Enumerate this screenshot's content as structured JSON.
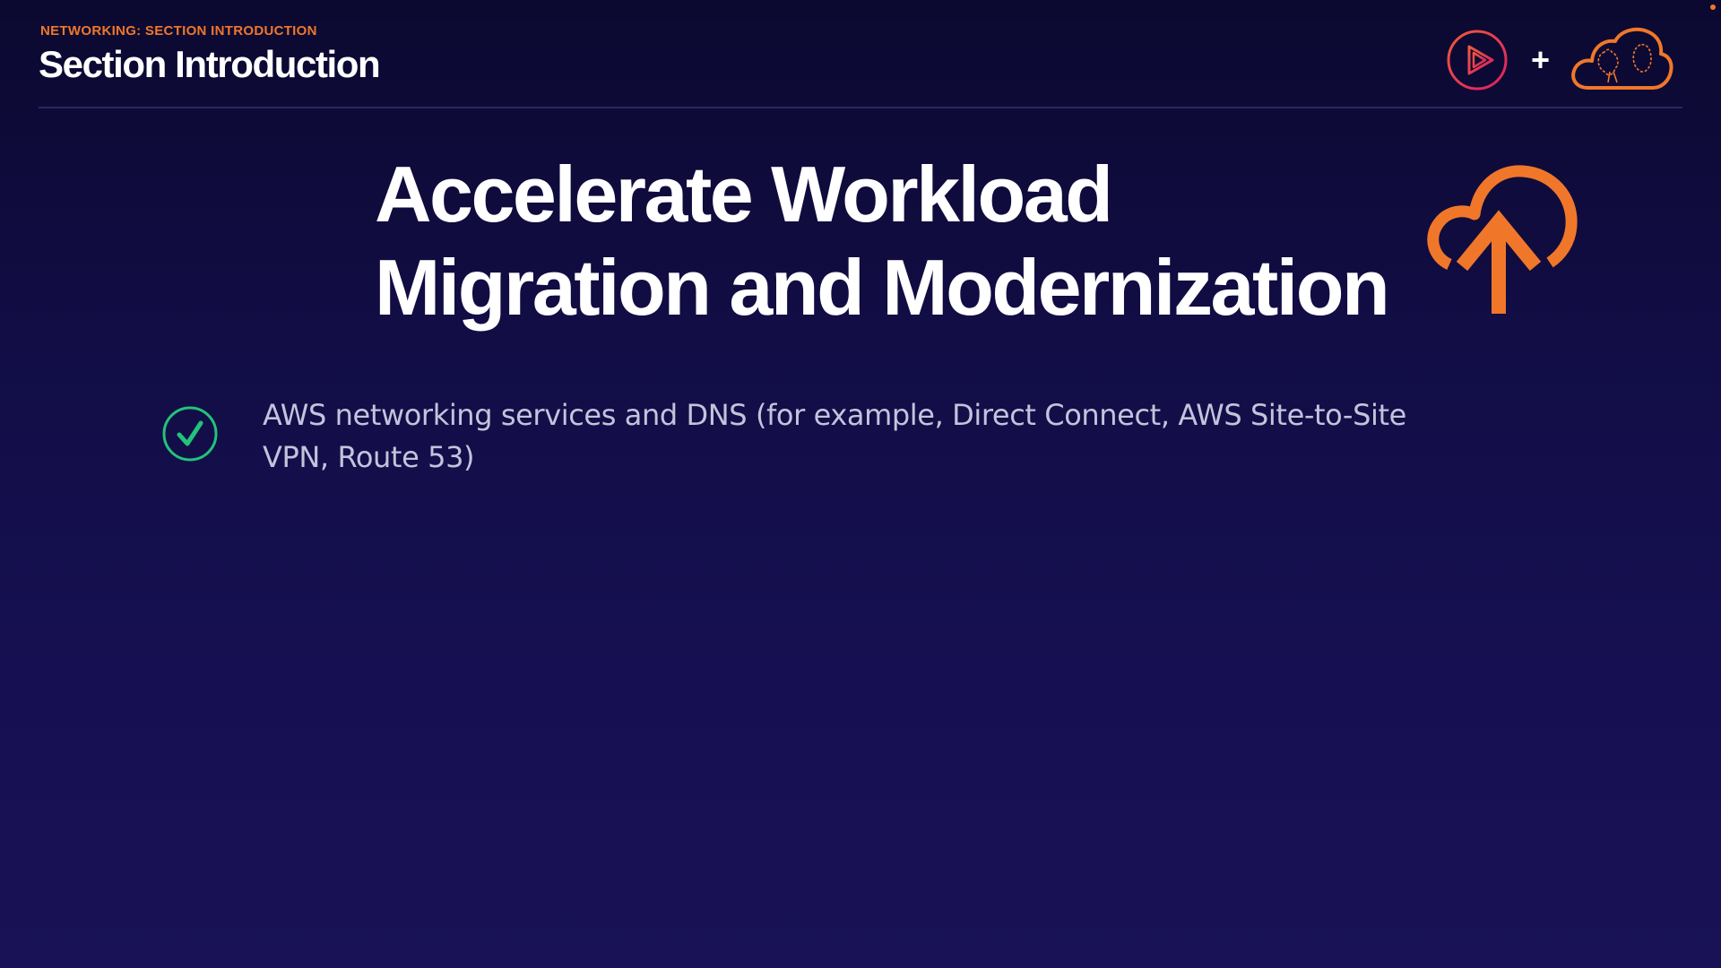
{
  "header": {
    "eyebrow": "NETWORKING: SECTION INTRODUCTION",
    "title": "Section Introduction",
    "plus": "+"
  },
  "logos": {
    "left": "play-logo-icon",
    "right": "cloud-brain-logo-icon"
  },
  "main": {
    "title_line_1": "Accelerate Workload",
    "title_line_2": "Migration and Modernization",
    "title_icon": "cloud-upload-icon",
    "bullets": [
      {
        "icon": "check-circle-icon",
        "text": "AWS networking services and DNS (for example, Direct Connect, AWS Site-to-Site VPN, Route 53)"
      }
    ]
  },
  "colors": {
    "accent_orange": "#f0772a",
    "check_green": "#22c37a",
    "ps_red": "#e0305a",
    "background_top": "#0b0930",
    "background_bottom": "#191256"
  }
}
